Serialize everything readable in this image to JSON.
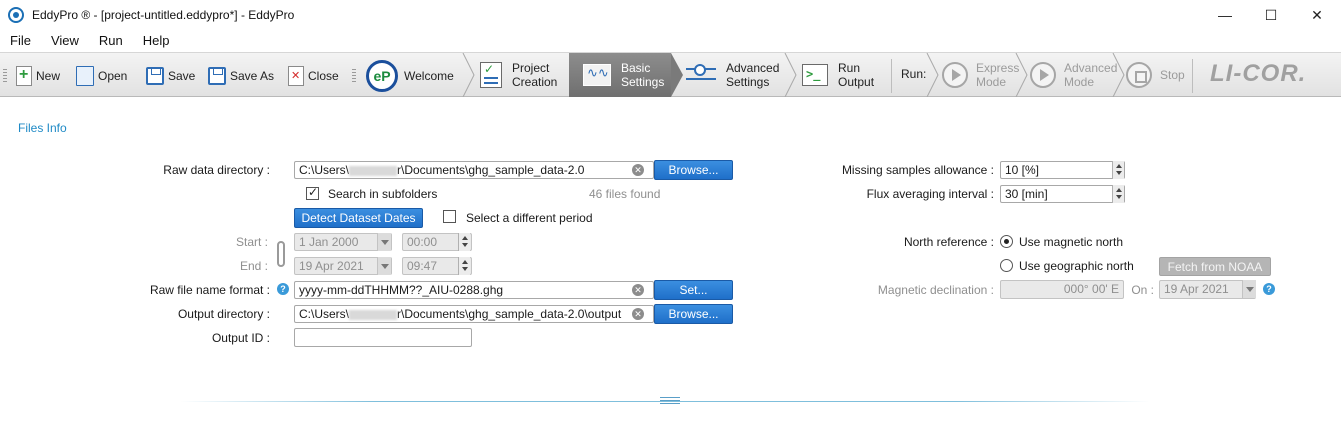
{
  "window": {
    "title": "EddyPro ® - [project-untitled.eddypro*] - EddyPro",
    "minimize": "—",
    "maximize": "☐",
    "close": "✕"
  },
  "menu": [
    "File",
    "View",
    "Run",
    "Help"
  ],
  "toolbar": {
    "new": "New",
    "open": "Open",
    "save": "Save",
    "save_as": "Save As",
    "close": "Close",
    "welcome": "Welcome",
    "project_creation": [
      "Project",
      "Creation"
    ],
    "basic_settings": [
      "Basic",
      "Settings"
    ],
    "advanced_settings": [
      "Advanced",
      "Settings"
    ],
    "run_output": [
      "Run",
      "Output"
    ],
    "run_label": "Run:",
    "express_mode": [
      "Express",
      "Mode"
    ],
    "advanced_mode": [
      "Advanced",
      "Mode"
    ],
    "stop": "Stop",
    "brand": "LI-COR."
  },
  "section_title": "Files Info",
  "files": {
    "raw_data_dir_label": "Raw data directory :",
    "raw_data_dir_prefix": "C:\\Users\\",
    "raw_data_dir_suffix": "r\\Documents\\ghg_sample_data-2.0",
    "browse": "Browse...",
    "search_subfolders": "Search in subfolders",
    "files_found": "46 files found",
    "detect_dates": "Detect Dataset Dates",
    "select_period": "Select a different period",
    "start_label": "Start :",
    "start_date": "1 Jan 2000",
    "start_time": "00:00",
    "end_label": "End :",
    "end_date": "19 Apr 2021",
    "end_time": "09:47",
    "raw_format_label": "Raw file name format :",
    "raw_format_value": "yyyy-mm-ddTHHMM??_AIU-0288.ghg",
    "set": "Set...",
    "output_dir_label": "Output directory :",
    "output_dir_prefix": "C:\\Users\\",
    "output_dir_suffix": "r\\Documents\\ghg_sample_data-2.0\\output",
    "browse2": "Browse...",
    "output_id_label": "Output ID :",
    "output_id_value": ""
  },
  "right": {
    "missing_label": "Missing samples allowance :",
    "missing_value": "10  [%]",
    "flux_label": "Flux averaging interval :",
    "flux_value": "30 [min]",
    "north_label": "North reference :",
    "magnetic": "Use magnetic north",
    "geographic": "Use geographic north",
    "fetch": "Fetch from NOAA",
    "declination_label": "Magnetic declination :",
    "declination_value": "000° 00' E",
    "on_label": "On :",
    "on_date": "19 Apr 2021"
  }
}
